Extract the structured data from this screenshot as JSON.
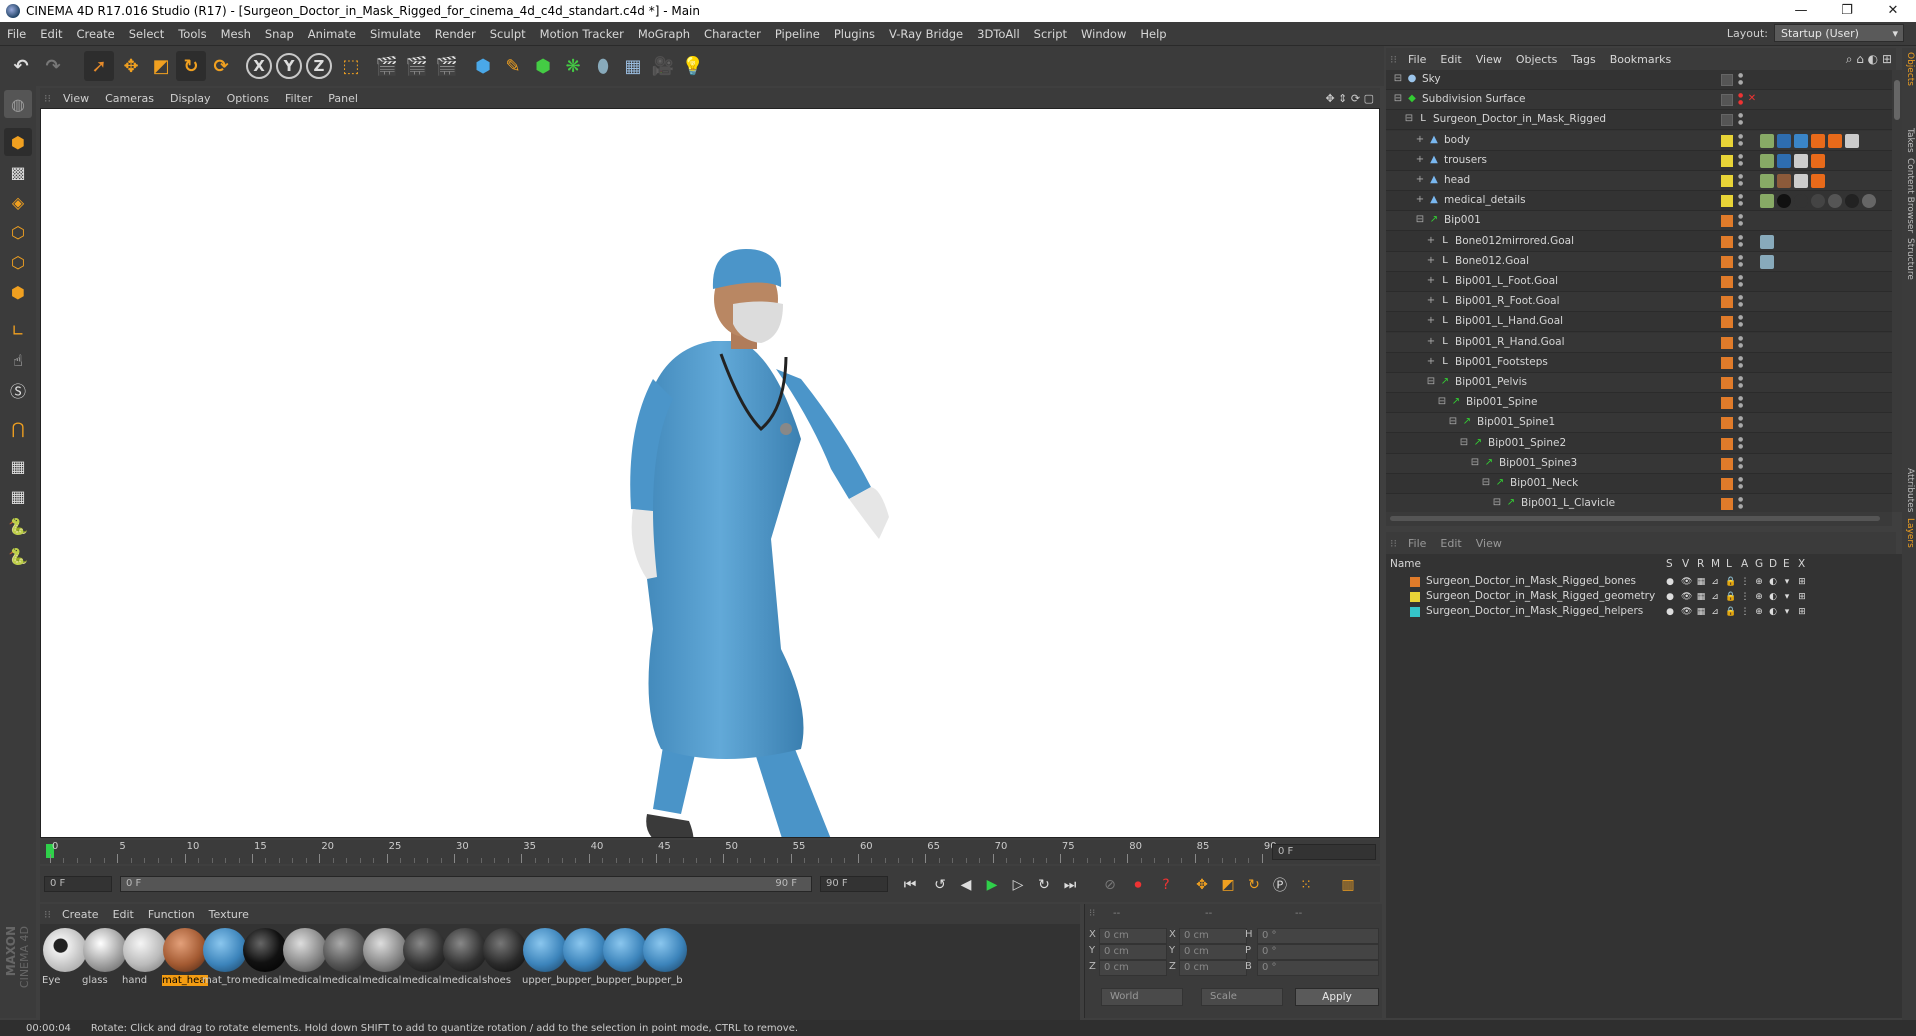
{
  "window": {
    "title": "CINEMA 4D R17.016 Studio (R17) - [Surgeon_Doctor_in_Mask_Rigged_for_cinema_4d_c4d_standart.c4d *] - Main",
    "minimize": "—",
    "maximize": "❐",
    "close": "✕"
  },
  "menu": [
    "File",
    "Edit",
    "Create",
    "Select",
    "Tools",
    "Mesh",
    "Snap",
    "Animate",
    "Simulate",
    "Render",
    "Sculpt",
    "Motion Tracker",
    "MoGraph",
    "Character",
    "Pipeline",
    "Plugins",
    "V-Ray Bridge",
    "3DToAll",
    "Script",
    "Window",
    "Help"
  ],
  "layout": {
    "label": "Layout:",
    "value": "Startup (User)"
  },
  "toolbar": {
    "undo_icon": "undo-icon",
    "redo_icon": "redo-icon",
    "axis_x": "X",
    "axis_y": "Y",
    "axis_z": "Z"
  },
  "viewport": {
    "menu": [
      "View",
      "Cameras",
      "Display",
      "Options",
      "Filter",
      "Panel"
    ]
  },
  "timeline": {
    "ticks": [
      "0",
      "5",
      "10",
      "15",
      "20",
      "25",
      "30",
      "35",
      "40",
      "45",
      "50",
      "55",
      "60",
      "65",
      "70",
      "75",
      "80",
      "85",
      "90"
    ],
    "current_frame": "0 F",
    "start_field": "0 F",
    "range_start": "0 F",
    "range_end": "90 F",
    "end_field": "90 F"
  },
  "materials": {
    "menu": [
      "Create",
      "Edit",
      "Function",
      "Texture"
    ],
    "items": [
      {
        "label": "Eye",
        "color": "eye"
      },
      {
        "label": "glass",
        "color": "glass"
      },
      {
        "label": "hand",
        "color": "hand"
      },
      {
        "label": "mat_hea",
        "color": "head",
        "selected": true
      },
      {
        "label": "mat_tro",
        "color": "blue"
      },
      {
        "label": "medical",
        "color": "black"
      },
      {
        "label": "medical",
        "color": "grey"
      },
      {
        "label": "medical",
        "color": "darkgrey"
      },
      {
        "label": "medical",
        "color": "grey"
      },
      {
        "label": "medical",
        "color": "darkgrey2"
      },
      {
        "label": "medical",
        "color": "darkgrey2"
      },
      {
        "label": "shoes",
        "color": "shoes"
      },
      {
        "label": "upper_b",
        "color": "blue"
      },
      {
        "label": "upper_b",
        "color": "blue"
      },
      {
        "label": "upper_b",
        "color": "blue"
      },
      {
        "label": "upper_b",
        "color": "blue"
      }
    ]
  },
  "coords": {
    "header": [
      "--",
      "--",
      "--"
    ],
    "rows": [
      {
        "a": "X",
        "av": "0 cm",
        "b": "X",
        "bv": "0 cm",
        "c": "H",
        "cv": "0 °"
      },
      {
        "a": "Y",
        "av": "0 cm",
        "b": "Y",
        "bv": "0 cm",
        "c": "P",
        "cv": "0 °"
      },
      {
        "a": "Z",
        "av": "0 cm",
        "b": "Z",
        "bv": "0 cm",
        "c": "B",
        "cv": "0 °"
      }
    ],
    "space": "World",
    "mode": "Scale",
    "apply": "Apply"
  },
  "status": {
    "time": "00:00:04",
    "message": "Rotate: Click and drag to rotate elements. Hold down SHIFT to add to quantize rotation / add to the selection in point mode, CTRL to remove."
  },
  "brand": {
    "line1": "MAXON",
    "line2": "CINEMA 4D"
  },
  "object_manager": {
    "menu": [
      "File",
      "Edit",
      "View",
      "Objects",
      "Tags",
      "Bookmarks"
    ],
    "objects": [
      {
        "name": "Sky",
        "indent": 0,
        "icon": "sky-icon",
        "layer": "none"
      },
      {
        "name": "Subdivision Surface",
        "indent": 0,
        "icon": "subdivision-icon",
        "layer": "none"
      },
      {
        "name": "Surgeon_Doctor_in_Mask_Rigged",
        "indent": 1,
        "icon": "null-icon",
        "layer": "none"
      },
      {
        "name": "body",
        "indent": 2,
        "icon": "polygon-icon",
        "layer": "yellow"
      },
      {
        "name": "trousers",
        "indent": 2,
        "icon": "polygon-icon",
        "layer": "yellow"
      },
      {
        "name": "head",
        "indent": 2,
        "icon": "polygon-icon",
        "layer": "yellow"
      },
      {
        "name": "medical_details",
        "indent": 2,
        "icon": "polygon-icon",
        "layer": "yellow"
      },
      {
        "name": "Bip001",
        "indent": 2,
        "icon": "bone-icon",
        "layer": "orange"
      },
      {
        "name": "Bone012mirrored.Goal",
        "indent": 3,
        "icon": "null-icon",
        "layer": "orange"
      },
      {
        "name": "Bone012.Goal",
        "indent": 3,
        "icon": "null-icon",
        "layer": "orange"
      },
      {
        "name": "Bip001_L_Foot.Goal",
        "indent": 3,
        "icon": "null-icon",
        "layer": "orange"
      },
      {
        "name": "Bip001_R_Foot.Goal",
        "indent": 3,
        "icon": "null-icon",
        "layer": "orange"
      },
      {
        "name": "Bip001_L_Hand.Goal",
        "indent": 3,
        "icon": "null-icon",
        "layer": "orange"
      },
      {
        "name": "Bip001_R_Hand.Goal",
        "indent": 3,
        "icon": "null-icon",
        "layer": "orange"
      },
      {
        "name": "Bip001_Footsteps",
        "indent": 3,
        "icon": "null-icon",
        "layer": "orange"
      },
      {
        "name": "Bip001_Pelvis",
        "indent": 3,
        "icon": "bone-icon",
        "layer": "orange"
      },
      {
        "name": "Bip001_Spine",
        "indent": 4,
        "icon": "bone-icon",
        "layer": "orange"
      },
      {
        "name": "Bip001_Spine1",
        "indent": 5,
        "icon": "bone-icon",
        "layer": "orange"
      },
      {
        "name": "Bip001_Spine2",
        "indent": 6,
        "icon": "bone-icon",
        "layer": "orange"
      },
      {
        "name": "Bip001_Spine3",
        "indent": 7,
        "icon": "bone-icon",
        "layer": "orange"
      },
      {
        "name": "Bip001_Neck",
        "indent": 8,
        "icon": "bone-icon",
        "layer": "orange"
      },
      {
        "name": "Bip001_L_Clavicle",
        "indent": 9,
        "icon": "bone-icon",
        "layer": "orange"
      }
    ]
  },
  "layer_manager": {
    "menu": [
      "File",
      "Edit",
      "View"
    ],
    "columns": [
      "Name",
      "S",
      "V",
      "R",
      "M",
      "L",
      "A",
      "G",
      "D",
      "E",
      "X"
    ],
    "layers": [
      {
        "name": "Surgeon_Doctor_in_Mask_Rigged_bones",
        "color": "#e07b2a"
      },
      {
        "name": "Surgeon_Doctor_in_Mask_Rigged_geometry",
        "color": "#e8d437"
      },
      {
        "name": "Surgeon_Doctor_in_Mask_Rigged_helpers",
        "color": "#35c4c9"
      }
    ]
  },
  "side_tabs": [
    "Objects",
    "Takes",
    "Content Browser",
    "Structure",
    "Attributes",
    "Layers"
  ]
}
